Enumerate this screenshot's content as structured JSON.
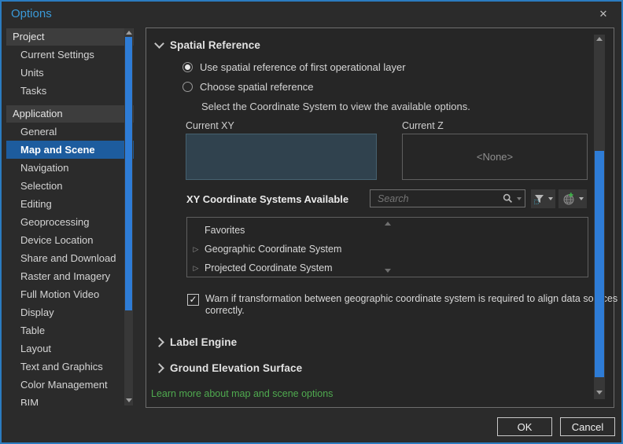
{
  "window": {
    "title": "Options"
  },
  "icons": {
    "close_icon": "✕",
    "check_icon": "✓",
    "tree_expand_icon": "▷",
    "search_icon": "magnifier",
    "filter_icon": "funnel-with-selection",
    "add_coordinate_system_icon": "globe-plus"
  },
  "colors": {
    "window_border_blue": "#2b7cc0",
    "title_blue": "#3a9ad9",
    "selected_item_blue": "#1d5c9e",
    "scrollbar_blue": "#2e7cd6",
    "link_green": "#4faa4f",
    "current_xy_fill": "#30424e"
  },
  "sidebar": {
    "project_header": "Project",
    "project_items": [
      "Current Settings",
      "Units",
      "Tasks"
    ],
    "application_header": "Application",
    "application_items": [
      "General",
      "Map and Scene",
      "Navigation",
      "Selection",
      "Editing",
      "Geoprocessing",
      "Device Location",
      "Share and Download",
      "Raster and Imagery",
      "Full Motion Video",
      "Display",
      "Table",
      "Layout",
      "Text and Graphics",
      "Color Management",
      "BIM"
    ],
    "selected_item": "Map and Scene"
  },
  "content": {
    "spatial": {
      "title": "Spatial Reference",
      "radio_first_layer": "Use spatial reference of first operational layer",
      "radio_choose": "Choose spatial reference",
      "select_hint": "Select the Coordinate System to view the available options.",
      "current_xy_label": "Current XY",
      "current_z_label": "Current Z",
      "current_z_value": "<None>",
      "xy_systems_label": "XY Coordinate Systems Available",
      "search_placeholder": "Search",
      "list_items": [
        "Favorites",
        "Geographic Coordinate System",
        "Projected Coordinate System"
      ],
      "warn_checkbox_label": "Warn if transformation between geographic coordinate system is required to align data sources correctly."
    },
    "section_label_engine": "Label Engine",
    "section_ground_elevation": "Ground Elevation Surface",
    "learn_more_link": "Learn more about map and scene options"
  },
  "footer": {
    "ok_label": "OK",
    "cancel_label": "Cancel"
  }
}
